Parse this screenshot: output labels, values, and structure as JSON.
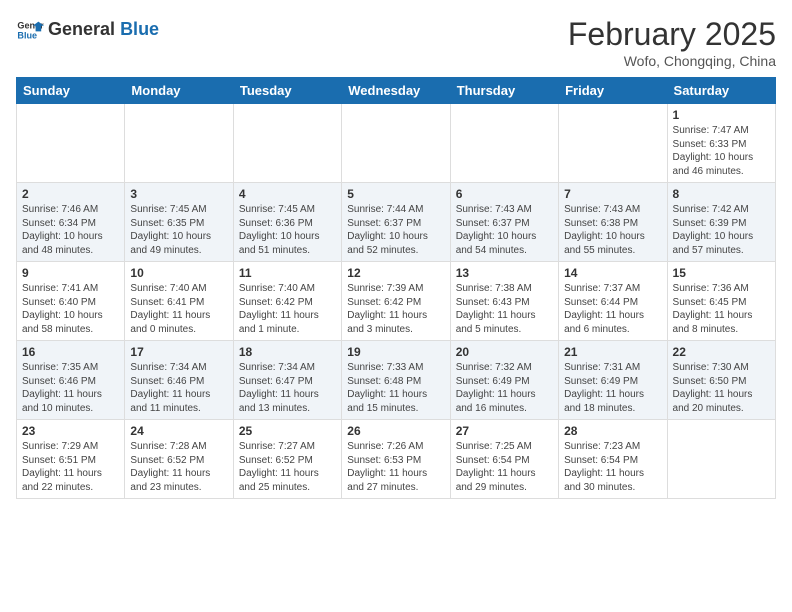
{
  "header": {
    "logo_general": "General",
    "logo_blue": "Blue",
    "month_year": "February 2025",
    "location": "Wofo, Chongqing, China"
  },
  "weekdays": [
    "Sunday",
    "Monday",
    "Tuesday",
    "Wednesday",
    "Thursday",
    "Friday",
    "Saturday"
  ],
  "weeks": [
    [
      {
        "day": "",
        "info": ""
      },
      {
        "day": "",
        "info": ""
      },
      {
        "day": "",
        "info": ""
      },
      {
        "day": "",
        "info": ""
      },
      {
        "day": "",
        "info": ""
      },
      {
        "day": "",
        "info": ""
      },
      {
        "day": "1",
        "info": "Sunrise: 7:47 AM\nSunset: 6:33 PM\nDaylight: 10 hours\nand 46 minutes."
      }
    ],
    [
      {
        "day": "2",
        "info": "Sunrise: 7:46 AM\nSunset: 6:34 PM\nDaylight: 10 hours\nand 48 minutes."
      },
      {
        "day": "3",
        "info": "Sunrise: 7:45 AM\nSunset: 6:35 PM\nDaylight: 10 hours\nand 49 minutes."
      },
      {
        "day": "4",
        "info": "Sunrise: 7:45 AM\nSunset: 6:36 PM\nDaylight: 10 hours\nand 51 minutes."
      },
      {
        "day": "5",
        "info": "Sunrise: 7:44 AM\nSunset: 6:37 PM\nDaylight: 10 hours\nand 52 minutes."
      },
      {
        "day": "6",
        "info": "Sunrise: 7:43 AM\nSunset: 6:37 PM\nDaylight: 10 hours\nand 54 minutes."
      },
      {
        "day": "7",
        "info": "Sunrise: 7:43 AM\nSunset: 6:38 PM\nDaylight: 10 hours\nand 55 minutes."
      },
      {
        "day": "8",
        "info": "Sunrise: 7:42 AM\nSunset: 6:39 PM\nDaylight: 10 hours\nand 57 minutes."
      }
    ],
    [
      {
        "day": "9",
        "info": "Sunrise: 7:41 AM\nSunset: 6:40 PM\nDaylight: 10 hours\nand 58 minutes."
      },
      {
        "day": "10",
        "info": "Sunrise: 7:40 AM\nSunset: 6:41 PM\nDaylight: 11 hours\nand 0 minutes."
      },
      {
        "day": "11",
        "info": "Sunrise: 7:40 AM\nSunset: 6:42 PM\nDaylight: 11 hours\nand 1 minute."
      },
      {
        "day": "12",
        "info": "Sunrise: 7:39 AM\nSunset: 6:42 PM\nDaylight: 11 hours\nand 3 minutes."
      },
      {
        "day": "13",
        "info": "Sunrise: 7:38 AM\nSunset: 6:43 PM\nDaylight: 11 hours\nand 5 minutes."
      },
      {
        "day": "14",
        "info": "Sunrise: 7:37 AM\nSunset: 6:44 PM\nDaylight: 11 hours\nand 6 minutes."
      },
      {
        "day": "15",
        "info": "Sunrise: 7:36 AM\nSunset: 6:45 PM\nDaylight: 11 hours\nand 8 minutes."
      }
    ],
    [
      {
        "day": "16",
        "info": "Sunrise: 7:35 AM\nSunset: 6:46 PM\nDaylight: 11 hours\nand 10 minutes."
      },
      {
        "day": "17",
        "info": "Sunrise: 7:34 AM\nSunset: 6:46 PM\nDaylight: 11 hours\nand 11 minutes."
      },
      {
        "day": "18",
        "info": "Sunrise: 7:34 AM\nSunset: 6:47 PM\nDaylight: 11 hours\nand 13 minutes."
      },
      {
        "day": "19",
        "info": "Sunrise: 7:33 AM\nSunset: 6:48 PM\nDaylight: 11 hours\nand 15 minutes."
      },
      {
        "day": "20",
        "info": "Sunrise: 7:32 AM\nSunset: 6:49 PM\nDaylight: 11 hours\nand 16 minutes."
      },
      {
        "day": "21",
        "info": "Sunrise: 7:31 AM\nSunset: 6:49 PM\nDaylight: 11 hours\nand 18 minutes."
      },
      {
        "day": "22",
        "info": "Sunrise: 7:30 AM\nSunset: 6:50 PM\nDaylight: 11 hours\nand 20 minutes."
      }
    ],
    [
      {
        "day": "23",
        "info": "Sunrise: 7:29 AM\nSunset: 6:51 PM\nDaylight: 11 hours\nand 22 minutes."
      },
      {
        "day": "24",
        "info": "Sunrise: 7:28 AM\nSunset: 6:52 PM\nDaylight: 11 hours\nand 23 minutes."
      },
      {
        "day": "25",
        "info": "Sunrise: 7:27 AM\nSunset: 6:52 PM\nDaylight: 11 hours\nand 25 minutes."
      },
      {
        "day": "26",
        "info": "Sunrise: 7:26 AM\nSunset: 6:53 PM\nDaylight: 11 hours\nand 27 minutes."
      },
      {
        "day": "27",
        "info": "Sunrise: 7:25 AM\nSunset: 6:54 PM\nDaylight: 11 hours\nand 29 minutes."
      },
      {
        "day": "28",
        "info": "Sunrise: 7:23 AM\nSunset: 6:54 PM\nDaylight: 11 hours\nand 30 minutes."
      },
      {
        "day": "",
        "info": ""
      }
    ]
  ]
}
